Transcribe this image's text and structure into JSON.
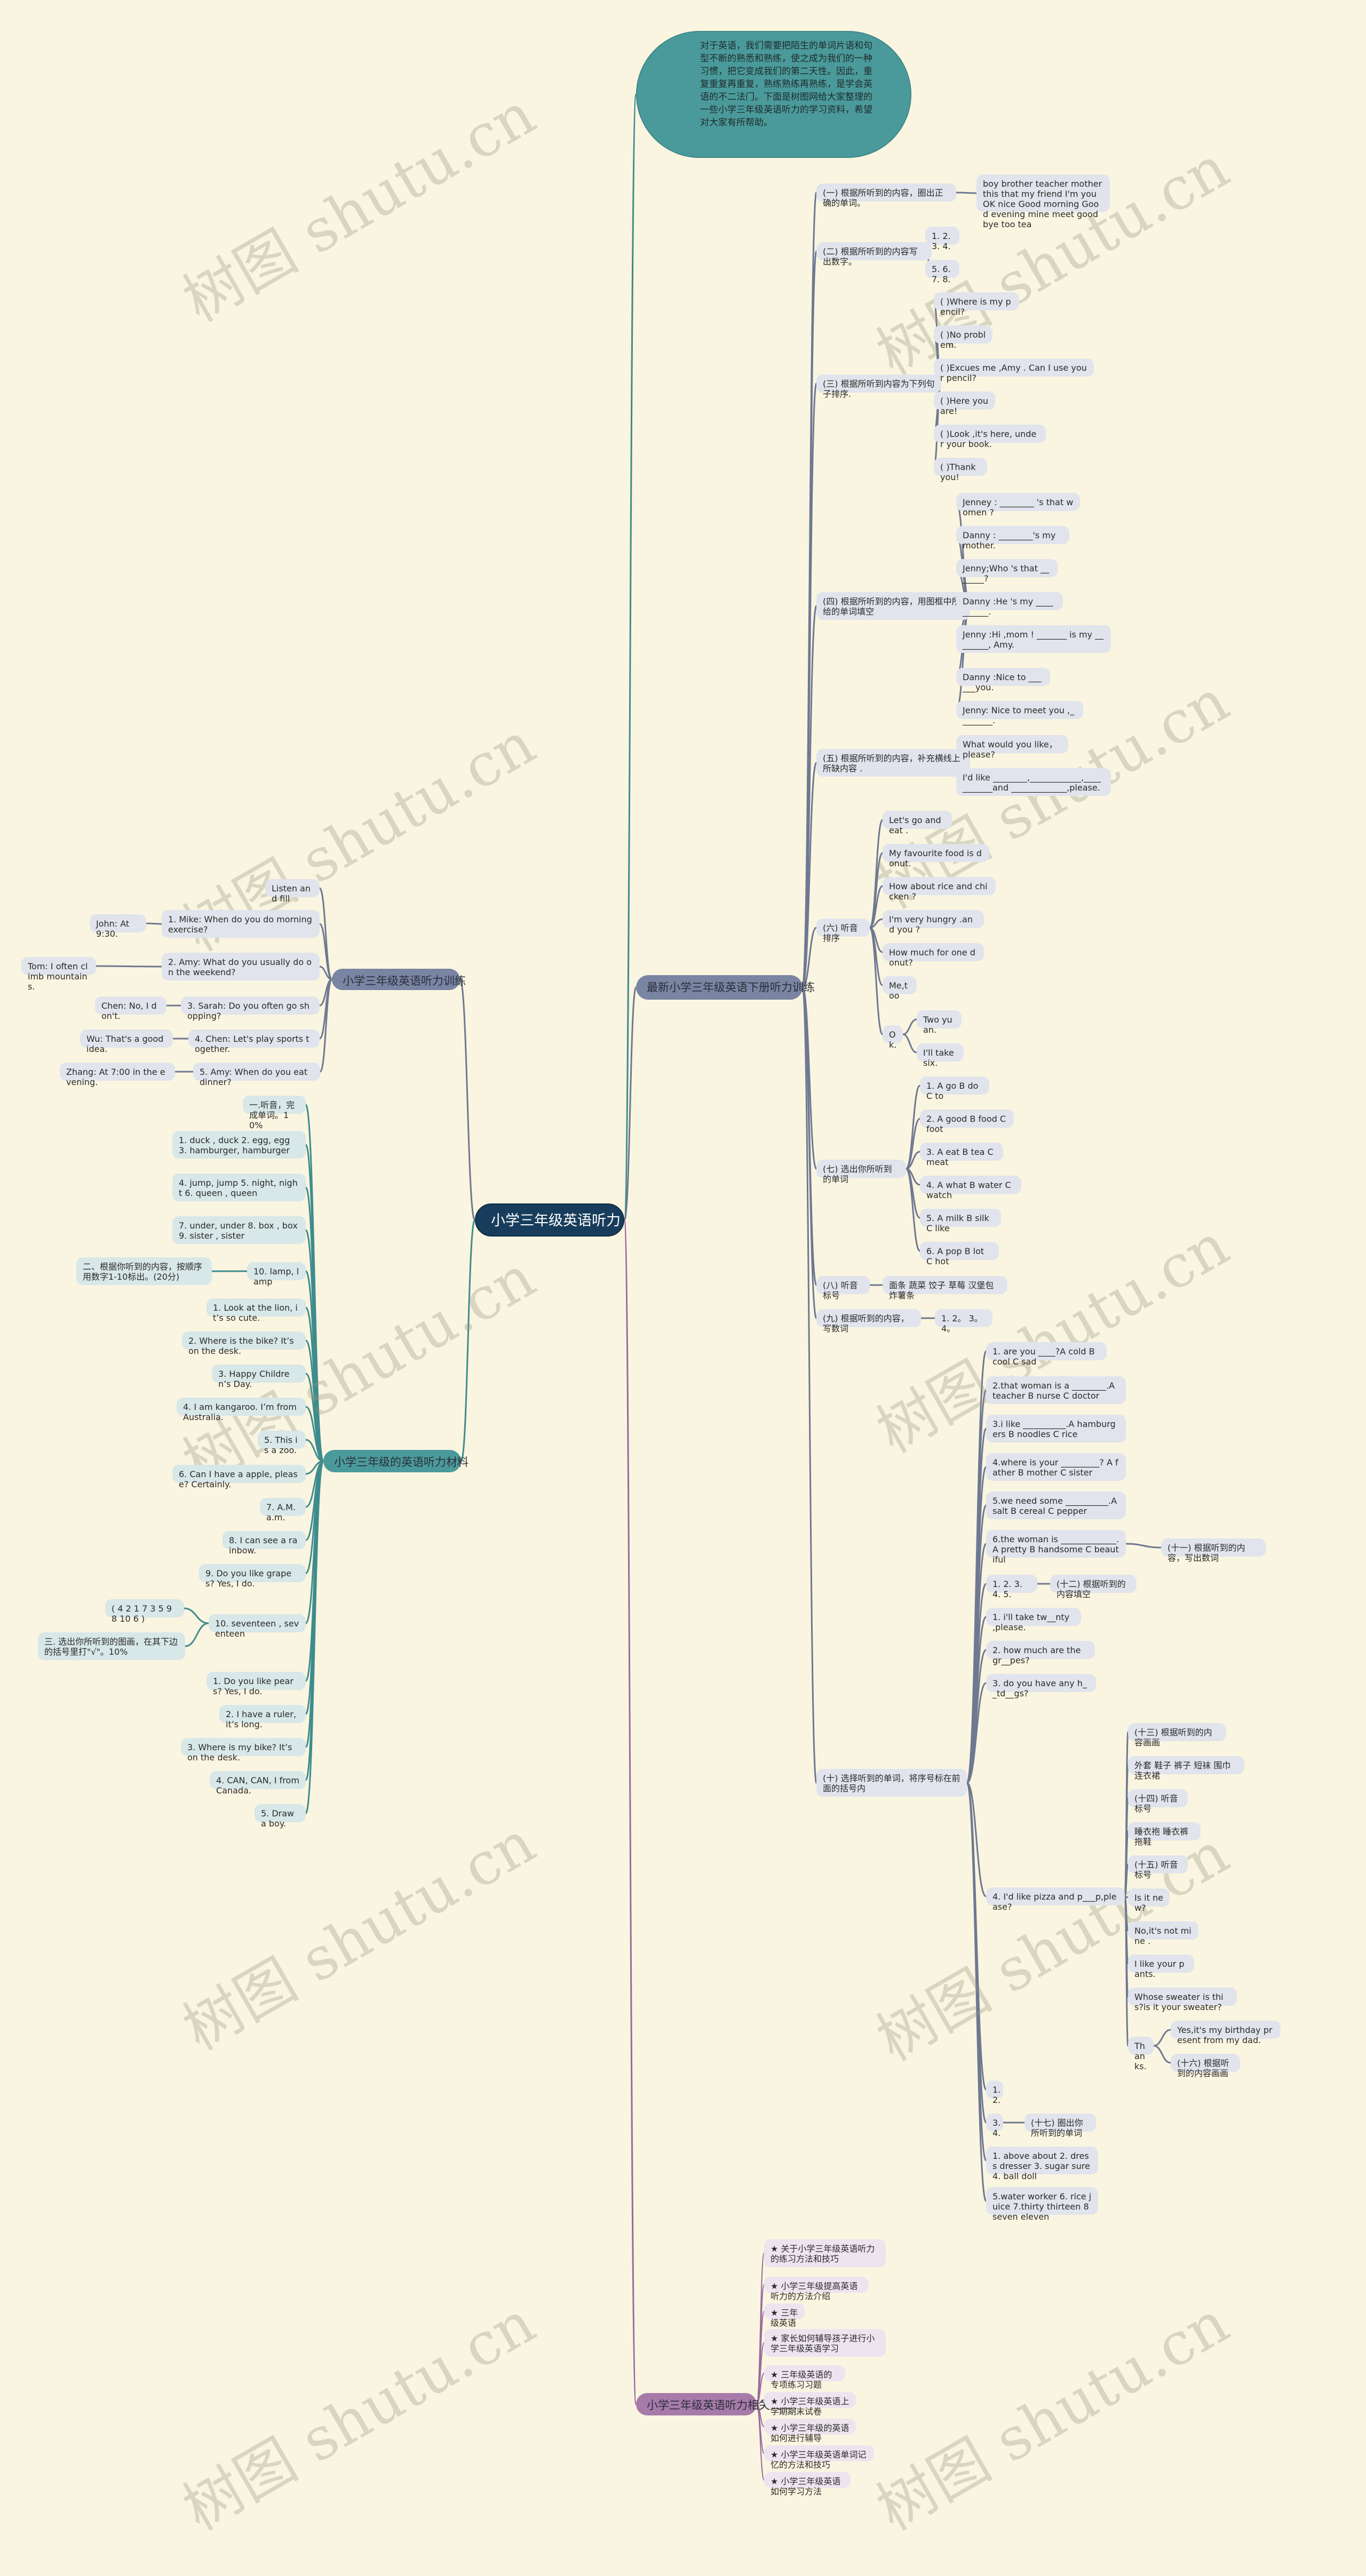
{
  "root": {
    "title": "小学三年级英语听力"
  },
  "intro": {
    "text": "对于英语，我们需要把陌生的单词片语和句型不断的熟悉和熟练，使之成为我们的一种习惯，把它变成我们的第二天性。因此，重复重复再重复，熟练熟练再熟练，是学会英语的不二法门。下面是树图网给大家整理的一些小学三年级英语听力的学习资料，希望对大家有所帮助。"
  },
  "watermark": {
    "text": "树图 shutu.cn"
  },
  "colors": {
    "background": "#faf5e0",
    "root": "#183d5c",
    "slate_branch": "#7a84a3",
    "teal_branch": "#4b9a9b",
    "purple_branch": "#a77aaa",
    "gray_node": "#e1e4ec",
    "teal_node": "#d8e7e8",
    "purple_node": "#ede4ef"
  },
  "right_main": {
    "label": "最新小学三年级英语下册听力训练",
    "sec1": {
      "label": "(一) 根据所听到的内容，圈出正确的单词。",
      "child": "boy brother teacher mother this that my friend I'm you OK nice Good morning Good evening mine meet goodbye too tea"
    },
    "sec2": {
      "label": "(二) 根据所听到的内容写出数字。",
      "children": [
        "1. 2. 3. 4.",
        "5. 6. 7. 8."
      ]
    },
    "sec3": {
      "label": "(三) 根据所听到内容为下列句子排序.",
      "children": [
        "( )Where is my pencil?",
        "( )No problem.",
        "( )Excues me ,Amy . Can I use your pencil?",
        "( )Here you are!",
        "( )Look ,it's here, under your book.",
        "( )Thank you!"
      ]
    },
    "sec4": {
      "label": "(四) 根据所听到的内容，用图框中所给的单词填空",
      "children": [
        "Jenney : ________ 's that women ?",
        "Danny : ________'s my mother.",
        "Jenny;Who 's that _______?",
        "Danny :He 's my __________.",
        "Jenny :Hi ,mom ! _______ is my ________, Amy.",
        "Danny :Nice to ______you.",
        "Jenny: Nice to meet you ,________."
      ]
    },
    "sec5": {
      "label": "(五) 根据所听到的内容，补充横线上所缺内容 .",
      "children": [
        "What would you like，please?",
        "I'd like ________,____________,___________and _____________,please."
      ]
    },
    "sec6": {
      "label": "(六) 听音排序",
      "children": [
        "Let's go and eat .",
        "My favourite food is donut.",
        "How about rice and chicken ?",
        "I'm very hungry .and you ?",
        "How much for one donut?",
        "Me,too",
        "Ok."
      ],
      "ok_children": [
        "Two yuan.",
        "I'll take six."
      ]
    },
    "sec7": {
      "label": "(七) 选出你所听到的单词",
      "children": [
        "1. A go B do C to",
        "2. A good B food C foot",
        "3. A eat B tea C meat",
        "4. A what B water C watch",
        "5. A milk B silk C like",
        "6. A pop B lot C hot"
      ]
    },
    "sec8": {
      "label": "(八) 听音标号",
      "child": "面条 蔬菜 饺子 草莓 汉堡包 炸薯条"
    },
    "sec9": {
      "label": "(九) 根据听到的内容，写数词",
      "child": "1. 2。 3。 4。"
    },
    "sec10": {
      "label": "(十) 选择听到的单词，将序号标在前面的括号内",
      "children": [
        "1. are you ____?A cold B cool C sad",
        "2.that woman is a ________.A teacher B nurse C doctor",
        "3.i like __________.A hamburgers B noodles C rice",
        "4.where is your _________? A father B mother C sister",
        "5.we need some __________.A salt B cereal C pepper",
        "6.the woman is _____________.A pretty B handsome C beautiful",
        "1. 2. 3. 4. 5.",
        "1. i'll take tw__nty ,please.",
        "2. how much are the gr__pes?",
        "3. do you have any h__td__gs?",
        "4. I'd like pizza and p___p,please?",
        "1. 2.",
        "3. 4.",
        "1. above about 2. dress dresser 3. sugar sure 4. ball doll",
        "5.water worker 6. rice juice 7.thirty thirteen 8 seven eleven"
      ],
      "sec11_label": "(十一) 根据听到的内容，写出数词",
      "sec12_label": "(十二) 根据听到的内容填空",
      "sec17_label": "(十七) 圈出你所听到的单词",
      "pizza_children": [
        "(十三) 根据听到的内容画画",
        "外套 鞋子 裤子 短袜 围巾 连衣裙",
        "(十四) 听音标号",
        "睡衣袍 睡衣裤 拖鞋",
        "(十五) 听音标号",
        "Is it new?",
        "No,it's not mine .",
        "I like your pants.",
        "Whose sweater is this?is it your sweater?",
        "Thanks."
      ],
      "thanks_children": [
        "Yes,it's my birthday present from my dad.",
        "(十六) 根据听到的内容画画"
      ]
    }
  },
  "left_train": {
    "label": "小学三年级英语听力训练",
    "items": [
      {
        "q": "Listen and fill",
        "a": null
      },
      {
        "q": "1. Mike: When do you do morning exercise?",
        "a": "John: At 9:30."
      },
      {
        "q": "2. Amy: What do you usually do on the weekend?",
        "a": "Tom: I often climb mountains."
      },
      {
        "q": "3. Sarah: Do you often go shopping?",
        "a": "Chen: No, I don't."
      },
      {
        "q": "4. Chen: Let's play sports together.",
        "a": "Wu: That's a good idea."
      },
      {
        "q": "5. Amy: When do you eat dinner?",
        "a": "Zhang: At 7:00 in the evening."
      }
    ]
  },
  "left_material": {
    "label": "小学三年级的英语听力材料",
    "items": [
      "一.听音，完成单词。10%",
      "1. duck , duck 2. egg, egg 3. hamburger, hamburger",
      "4. jump, jump 5. night, night 6. queen , queen",
      "7. under, under 8. box , box 9. sister , sister",
      "10. lamp, lamp",
      "1. Look at the lion, it’s so cute.",
      "2. Where is the bike? It’s on the desk.",
      "3. Happy Children’s Day.",
      "4. I am kangaroo. I’m from Australia.",
      "5. This is a zoo.",
      "6. Can I have a apple, please? Certainly.",
      "7. A.M. a.m.",
      "8. I can see a rainbow.",
      "9. Do you like grapes? Yes, I do.",
      "10. seventeen , seventeen",
      "1. Do you like pears? Yes, I do.",
      "2. I have a ruler, it’s long.",
      "3. Where is my bike? It’s on the desk.",
      "4. CAN, CAN, I from Canada.",
      "5. Draw a boy."
    ],
    "lamp_child": "二、根据你听到的内容，按顺序用数字1-10标出。(20分)",
    "seventeen_children": [
      "( 4 2 1 7 3 5 9 8 10 6 )",
      "三. 选出你所听到的图画，在其下边的括号里打\"√\"。10%"
    ]
  },
  "related": {
    "label": "小学三年级英语听力相关文章：",
    "items": [
      "★ 关于小学三年级英语听力的练习方法和技巧",
      "★ 小学三年级提高英语听力的方法介绍",
      "★ 三年级英语",
      "★ 家长如何辅导孩子进行小学三年级英语学习",
      "★ 三年级英语的专项练习习题",
      "★ 小学三年级英语上学期期末试卷",
      "★ 小学三年级的英语如何进行辅导",
      "★ 小学三年级英语单词记忆的方法和技巧",
      "★ 小学三年级英语如何学习方法"
    ]
  }
}
